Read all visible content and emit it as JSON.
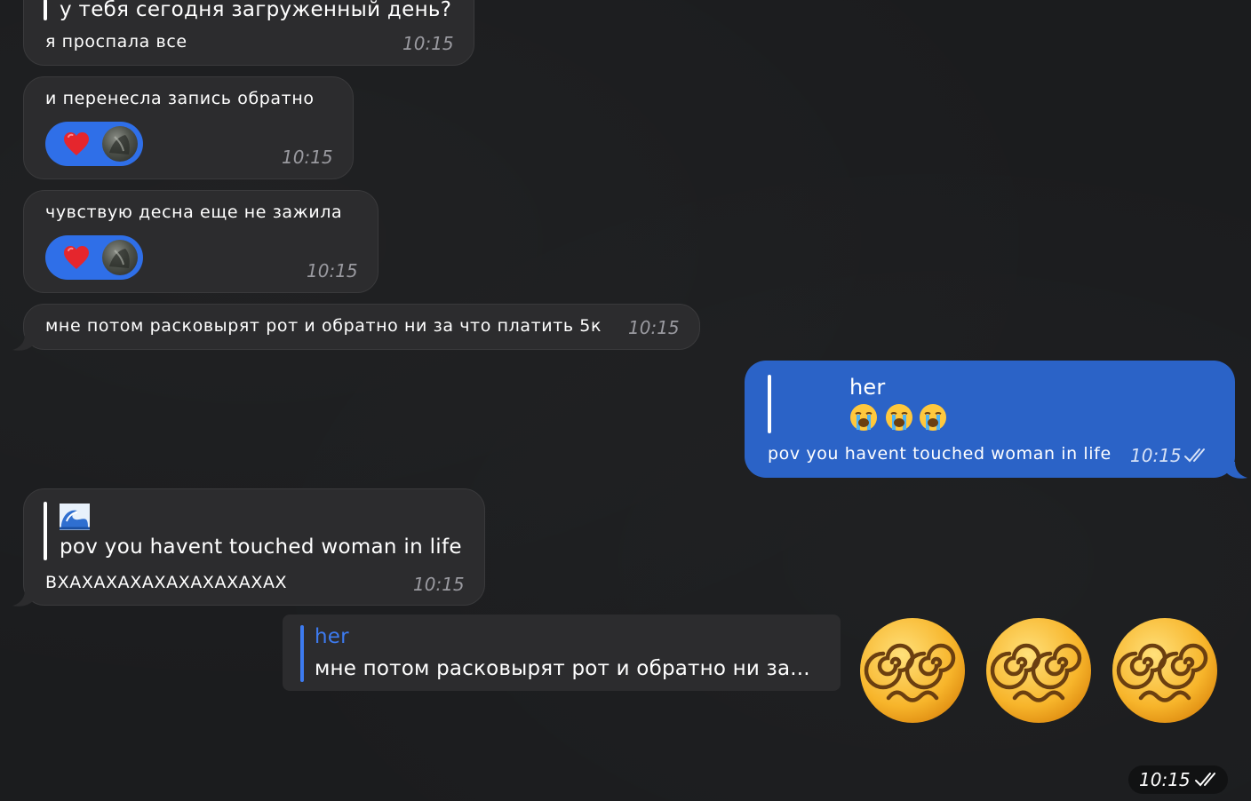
{
  "messages": {
    "m1": {
      "quote": "у тебя сегодня загруженный день?",
      "text": "я проспала все",
      "time": "10:15"
    },
    "m2": {
      "text": "и перенесла запись обратно",
      "time": "10:15",
      "reaction": "heart-emoji"
    },
    "m3": {
      "text": "чувствую десна еще не зажила",
      "time": "10:15",
      "reaction": "heart-emoji"
    },
    "m4": {
      "text": "мне потом расковырят рот и обратно ни за что платить 5к",
      "time": "10:15"
    },
    "m5": {
      "quote_author": "her",
      "quote_emoji": "loudly-crying-face x3",
      "text": "pov you havent touched woman in life",
      "time": "10:15",
      "status": "read"
    },
    "m6": {
      "quote_emoji": "water-wave",
      "quote_text": "pov you havent touched woman in life",
      "text": "ВХАХАХАХАХАХАХАХАХАХ",
      "time": "10:15"
    },
    "m7": {
      "reply_author": "her",
      "reply_text": "мне потом расковырят рот и обратно ни за...",
      "emoji": "face-with-spiral-eyes x3",
      "time": "10:15",
      "status": "read"
    }
  },
  "colors": {
    "background": "#1b1c1e",
    "incoming_bubble": "#2c2c2e",
    "outgoing_bubble": "#2b63c7",
    "reaction_pill": "#2f6fe8",
    "reply_accent": "#3d7bf0"
  }
}
